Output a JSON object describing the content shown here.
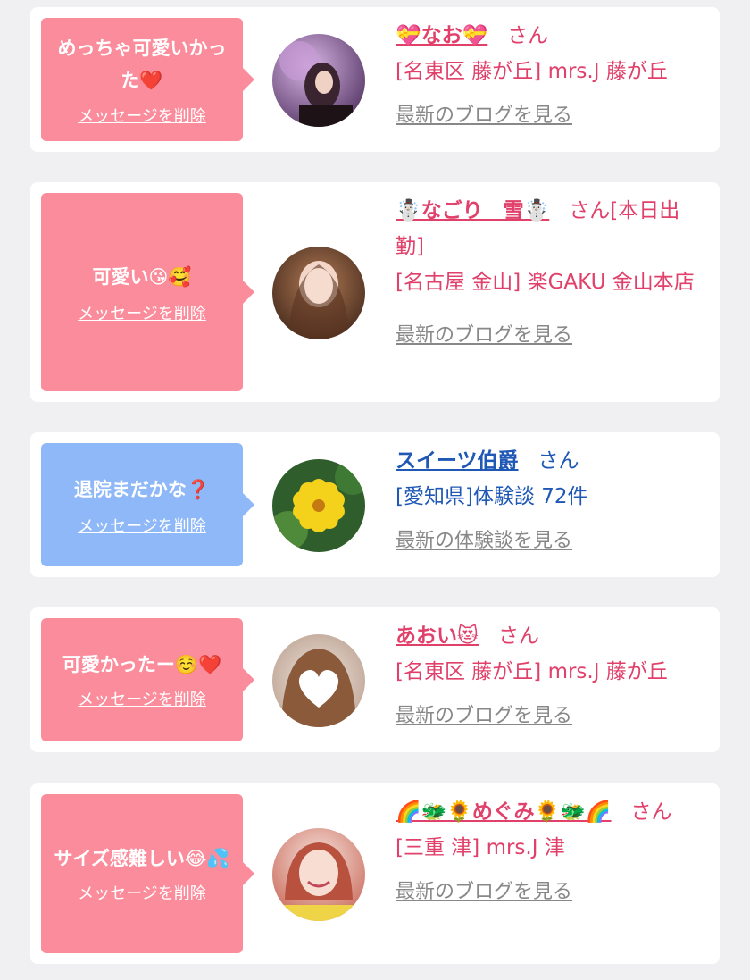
{
  "items": [
    {
      "message": "めっちゃ可愛いかった❤️",
      "delete_label": "メッセージを削除",
      "name": "💝なお💝",
      "honorific": "さん",
      "status": "",
      "shop": "[名東区 藤が丘] mrs.J 藤が丘",
      "link_label": "最新のブログを見る",
      "bubble_color": "#fb8c9b",
      "text_color": "#e0406a"
    },
    {
      "message": "可愛い😘🥰",
      "delete_label": "メッセージを削除",
      "name": "☃️なごり　雪☃️",
      "honorific": "さん",
      "status": "[本日出勤]",
      "shop": "[名古屋 金山] 楽GAKU 金山本店",
      "link_label": "最新のブログを見る",
      "bubble_color": "#fb8c9b",
      "text_color": "#e0406a"
    },
    {
      "message": "退院まだかな❓",
      "delete_label": "メッセージを削除",
      "name": "スイーツ伯爵",
      "honorific": "さん",
      "status": "",
      "shop": "[愛知県]体験談 72件",
      "link_label": "最新の体験談を見る",
      "bubble_color": "#8eb8f7",
      "text_color": "#1f58b5"
    },
    {
      "message": "可愛かったー☺️❤️",
      "delete_label": "メッセージを削除",
      "name": "あおい😻",
      "honorific": "さん",
      "status": "",
      "shop": "[名東区 藤が丘] mrs.J 藤が丘",
      "link_label": "最新のブログを見る",
      "bubble_color": "#fb8c9b",
      "text_color": "#e0406a"
    },
    {
      "message": "サイズ感難しい😂💦",
      "delete_label": "メッセージを削除",
      "name": "🌈🐲🌻めぐみ🌻🐲🌈",
      "honorific": "さん",
      "status": "",
      "shop": "[三重 津] mrs.J 津",
      "link_label": "最新のブログを見る",
      "bubble_color": "#fb8c9b",
      "text_color": "#e0406a"
    }
  ]
}
